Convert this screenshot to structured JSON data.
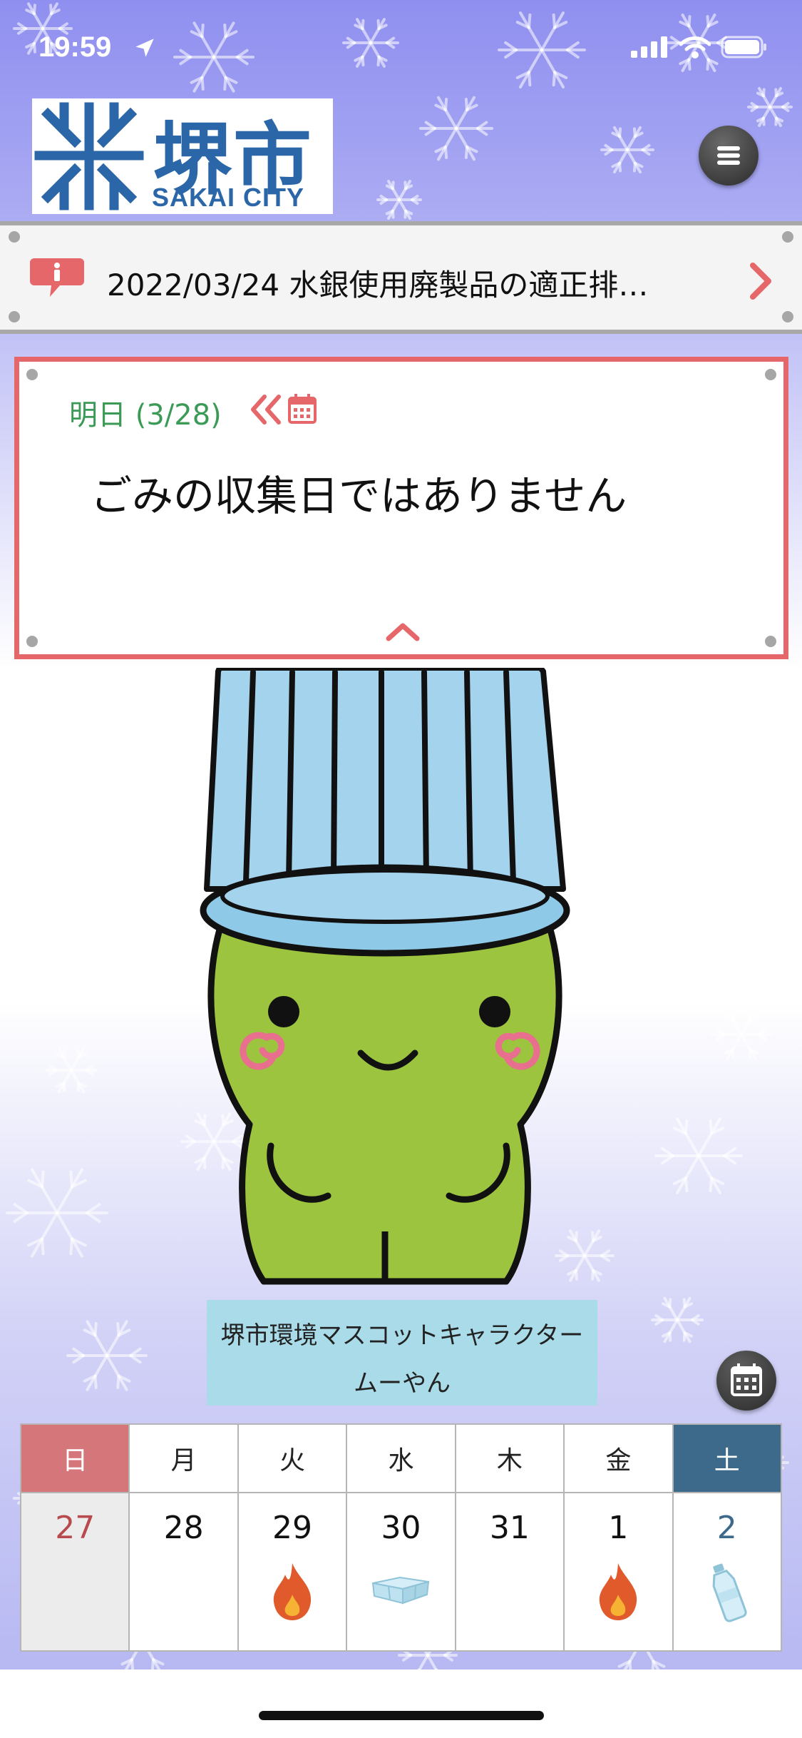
{
  "status_bar": {
    "time": "19:59"
  },
  "logo": {
    "kanji": "堺市",
    "roman": "SAKAI CITY"
  },
  "news": {
    "text": "2022/03/24 水銀使用廃製品の適正排…"
  },
  "notice": {
    "day": "明日 (3/28)",
    "message": "ごみの収集日ではありません"
  },
  "mascot": {
    "caption_line1": "堺市環境マスコットキャラクター",
    "caption_line2": "ムーやん"
  },
  "calendar": {
    "headers": [
      "日",
      "月",
      "火",
      "水",
      "木",
      "金",
      "土"
    ],
    "days": [
      {
        "date": "27",
        "icon": ""
      },
      {
        "date": "28",
        "icon": ""
      },
      {
        "date": "29",
        "icon": "flame-icon"
      },
      {
        "date": "30",
        "icon": "container-icon"
      },
      {
        "date": "31",
        "icon": ""
      },
      {
        "date": "1",
        "icon": "flame-icon"
      },
      {
        "date": "2",
        "icon": "bottle-icon"
      }
    ]
  },
  "colors": {
    "accent_red": "#e6676a",
    "green": "#3c9a57",
    "saturday": "#3d6a8a",
    "sunday": "#d4767a",
    "caption_bg": "#a9dbe8"
  }
}
